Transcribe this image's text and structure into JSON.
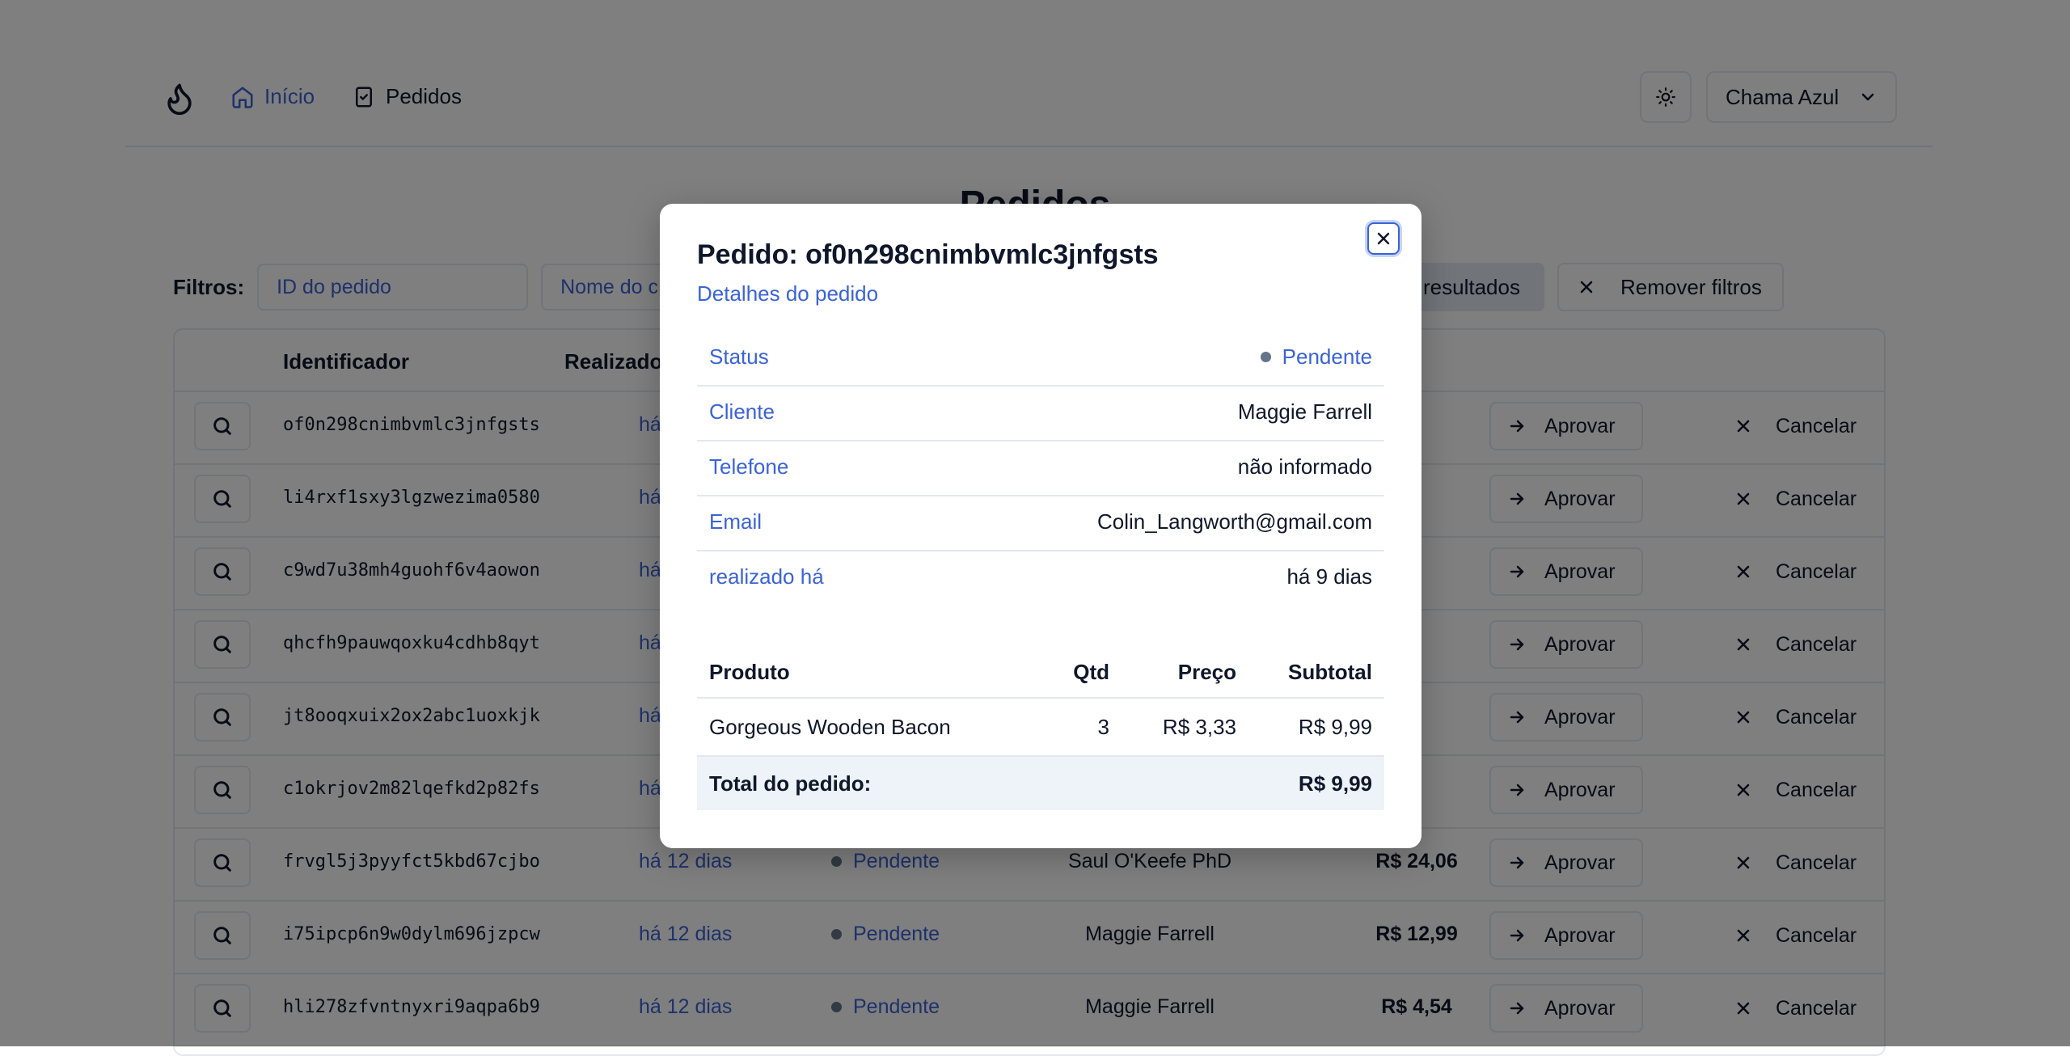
{
  "header": {
    "nav_home": "Início",
    "nav_orders": "Pedidos",
    "store_name": "Chama Azul"
  },
  "page": {
    "title": "Pedidos"
  },
  "filters": {
    "label": "Filtros:",
    "order_id_placeholder": "ID do pedido",
    "customer_name_placeholder": "Nome do c",
    "filter_button": "resultados",
    "remove_button": "Remover filtros"
  },
  "table": {
    "headers": {
      "id": "Identificador",
      "date": "Realizado"
    },
    "approve_label": "Aprovar",
    "cancel_label": "Cancelar",
    "rows": [
      {
        "id": "of0n298cnimbvmlc3jnfgsts",
        "date": "há",
        "status": "",
        "customer": "",
        "total": ""
      },
      {
        "id": "li4rxf1sxy3lgzwezima0580",
        "date": "há",
        "status": "",
        "customer": "",
        "total": ""
      },
      {
        "id": "c9wd7u38mh4guohf6v4aowon",
        "date": "há",
        "status": "",
        "customer": "",
        "total": ""
      },
      {
        "id": "qhcfh9pauwqoxku4cdhb8qyt",
        "date": "há",
        "status": "",
        "customer": "",
        "total": ""
      },
      {
        "id": "jt8ooqxuix2ox2abc1uoxkjk",
        "date": "há",
        "status": "",
        "customer": "",
        "total": ""
      },
      {
        "id": "c1okrjov2m82lqefkd2p82fs",
        "date": "há",
        "status": "",
        "customer": "",
        "total": ""
      },
      {
        "id": "frvgl5j3pyyfct5kbd67cjbo",
        "date": "há 12 dias",
        "status": "Pendente",
        "customer": "Saul O'Keefe PhD",
        "total": "R$ 24,06"
      },
      {
        "id": "i75ipcp6n9w0dylm696jzpcw",
        "date": "há 12 dias",
        "status": "Pendente",
        "customer": "Maggie Farrell",
        "total": "R$ 12,99"
      },
      {
        "id": "hli278zfvntnyxri9aqpa6b9",
        "date": "há 12 dias",
        "status": "Pendente",
        "customer": "Maggie Farrell",
        "total": "R$ 4,54"
      }
    ]
  },
  "modal": {
    "title": "Pedido: of0n298cnimbvmlc3jnfgsts",
    "subtitle": "Detalhes do pedido",
    "details": {
      "status_label": "Status",
      "status_value": "Pendente",
      "customer_label": "Cliente",
      "customer_value": "Maggie Farrell",
      "phone_label": "Telefone",
      "phone_value": "não informado",
      "email_label": "Email",
      "email_value": "Colin_Langworth@gmail.com",
      "placed_label": "realizado há",
      "placed_value": "há 9 dias"
    },
    "items": {
      "headers": {
        "product": "Produto",
        "qty": "Qtd",
        "price": "Preço",
        "subtotal": "Subtotal"
      },
      "rows": [
        {
          "product": "Gorgeous Wooden Bacon",
          "qty": "3",
          "price": "R$ 3,33",
          "subtotal": "R$ 9,99"
        }
      ],
      "total_label": "Total do pedido:",
      "total_value": "R$ 9,99"
    }
  },
  "colors": {
    "accent": "#3b63d6",
    "text": "#0f172a",
    "border": "#e2e8f0",
    "overlay": "rgba(0,0,0,0.5)"
  }
}
